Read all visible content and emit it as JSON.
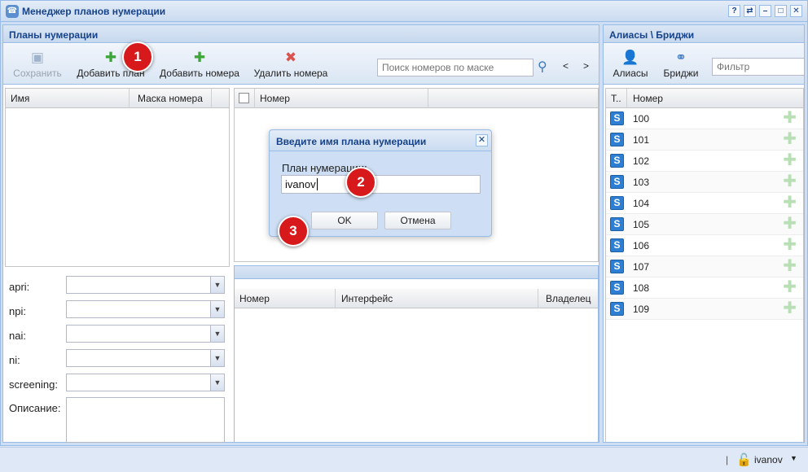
{
  "window": {
    "title": "Менеджер планов нумерации",
    "buttons": [
      "?",
      "⇄",
      "–",
      "□",
      "✕"
    ]
  },
  "plans": {
    "title": "Планы нумерации",
    "toolbar": {
      "save": "Сохранить",
      "add_plan": "Добавить план",
      "add_numbers": "Добавить номера",
      "delete_numbers": "Удалить номера"
    },
    "search_placeholder": "Поиск номеров по маске",
    "nav": {
      "prev": "<",
      "next": ">"
    },
    "plan_columns": {
      "name": "Имя",
      "mask": "Маска номера"
    },
    "number_columns": {
      "number": "Номер"
    },
    "bottom_columns": {
      "number": "Номер",
      "interface": "Интерфейс",
      "owner": "Владелец"
    },
    "fields": {
      "apri": "apri:",
      "npi": "npi:",
      "nai": "nai:",
      "ni": "ni:",
      "screening": "screening:",
      "description": "Описание:"
    }
  },
  "aliases": {
    "title": "Алиасы \\ Бриджи",
    "aliases_button": "Алиасы",
    "bridges_button": "Бриджи",
    "filter_placeholder": "Фильтр",
    "columns": {
      "type": "Т..",
      "number": "Номер"
    },
    "rows": [
      "100",
      "101",
      "102",
      "103",
      "104",
      "105",
      "106",
      "107",
      "108",
      "109"
    ]
  },
  "dialog": {
    "title": "Введите имя плана нумерации",
    "label": "План нумерации:",
    "value": "ivanov",
    "ok": "OK",
    "cancel": "Отмена"
  },
  "badges": [
    "1",
    "2",
    "3"
  ],
  "status": {
    "separator": "|",
    "user": "ivanov"
  },
  "colors": {
    "header_text": "#15428b",
    "badge": "#d7191c",
    "border": "#99bbe8"
  }
}
